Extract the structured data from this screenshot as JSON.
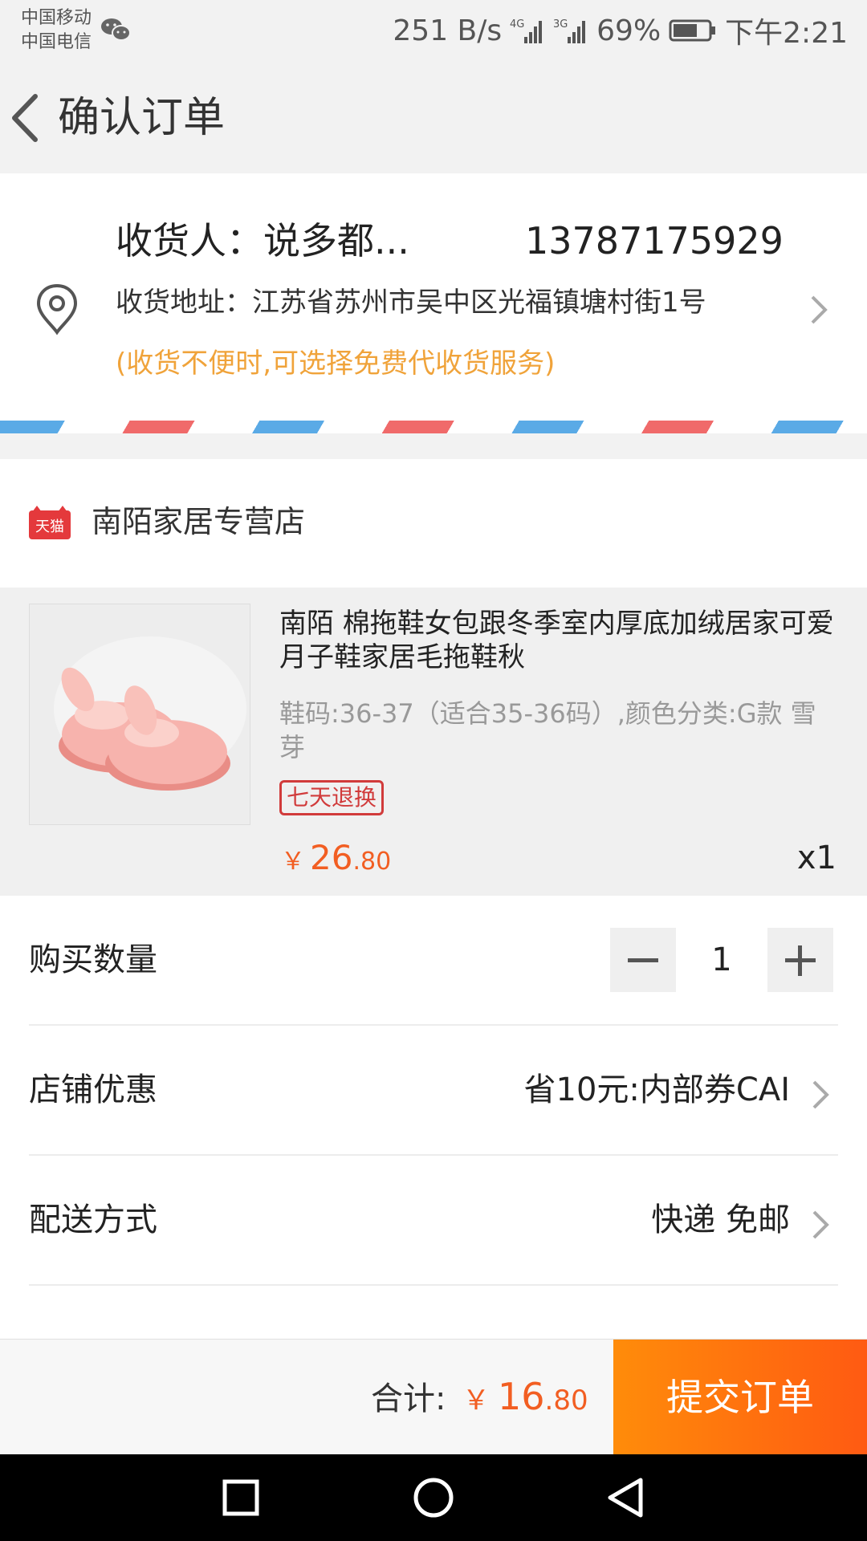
{
  "status_bar": {
    "carrier_1": "中国移动",
    "carrier_2": "中国电信",
    "net_speed": "251 B/s",
    "signal_1_label": "4G",
    "signal_2_label": "3G",
    "battery": "69%",
    "battery_level": 0.69,
    "time": "下午2:21"
  },
  "header": {
    "title": "确认订单"
  },
  "address": {
    "name": "收货人：说多都...",
    "phone": "13787175929",
    "line": "收货地址：江苏省苏州市吴中区光福镇塘村街1号",
    "hint": "(收货不便时,可选择免费代收货服务)"
  },
  "shop": {
    "logo_text": "天猫",
    "name": "南陌家居专营店"
  },
  "product": {
    "title": "南陌 棉拖鞋女包跟冬季室内厚底加绒居家可爱月子鞋家居毛拖鞋秋",
    "sku": "鞋码:36-37（适合35-36码）,颜色分类:G款 雪芽",
    "badge": "七天退换",
    "price_symbol": "￥",
    "price_int": "26",
    "price_dec": ".80",
    "quantity": "x1"
  },
  "rows": {
    "quantity_label": "购买数量",
    "quantity_value": "1",
    "coupon_label": "店铺优惠",
    "coupon_value": "省10元:内部券CAI",
    "shipping_label": "配送方式",
    "shipping_value": "快递 免邮"
  },
  "footer": {
    "total_label": "合计:",
    "price_symbol": "￥",
    "price_int": "16",
    "price_dec": ".80",
    "submit_label": "提交订单"
  },
  "colors": {
    "accent": "#f25e22",
    "hint": "#f0a33a",
    "badge": "#d13b3b",
    "submit_start": "#ff8c0a",
    "submit_end": "#ff5a12"
  }
}
